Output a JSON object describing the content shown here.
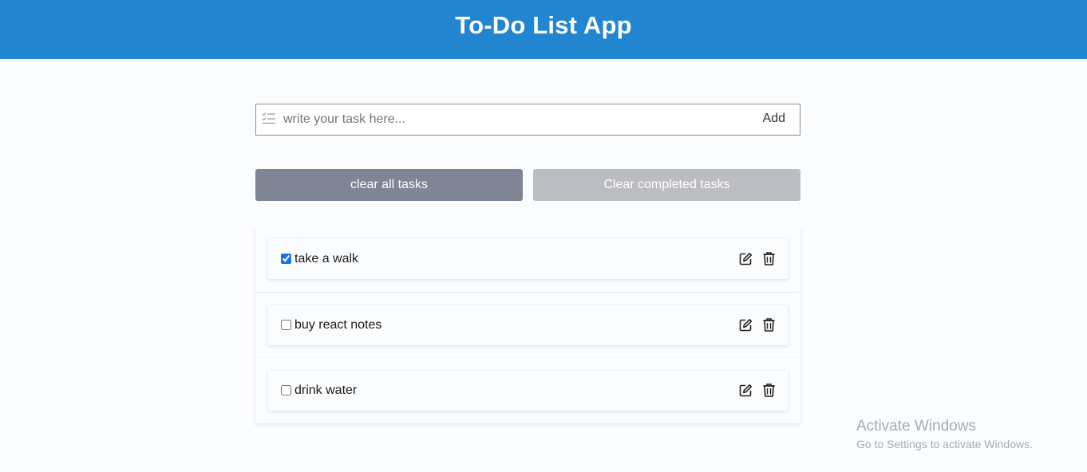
{
  "header": {
    "title": "To-Do List App"
  },
  "task_input": {
    "placeholder": "write your task here...",
    "value": "",
    "add_label": "Add"
  },
  "buttons": {
    "clear_all": "clear all tasks",
    "clear_completed": "Clear completed tasks"
  },
  "tasks": [
    {
      "text": "take a walk",
      "done": true
    },
    {
      "text": "buy react notes",
      "done": false
    },
    {
      "text": "drink water",
      "done": false
    }
  ],
  "watermark": {
    "title": "Activate Windows",
    "subtitle": "Go to Settings to activate Windows."
  },
  "icons": {
    "input": "checklist-icon",
    "edit": "edit-icon",
    "delete": "trash-icon"
  },
  "colors": {
    "header_bg": "#2185d0",
    "clear_all_bg": "#7f8595",
    "clear_completed_bg": "#bcbdc3",
    "checkbox_checked": "#1a73e8"
  }
}
